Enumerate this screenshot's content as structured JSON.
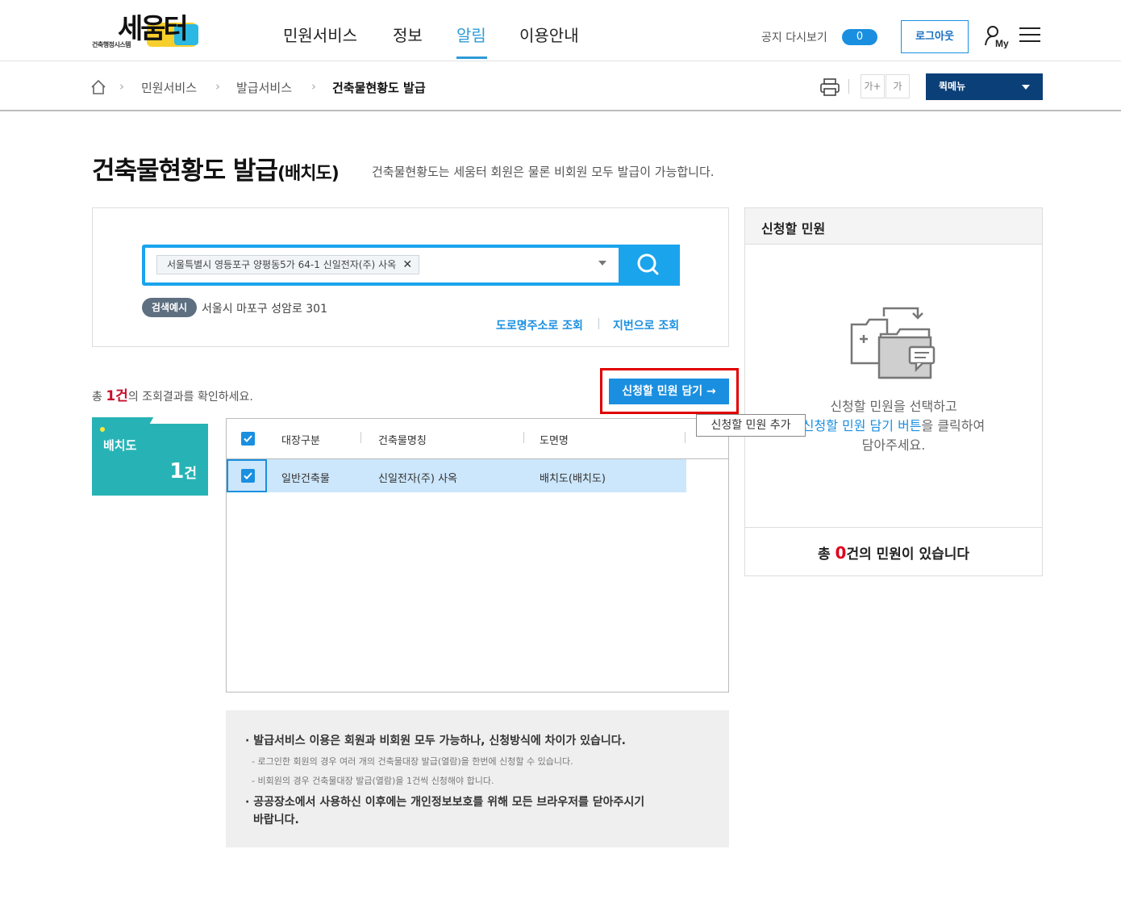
{
  "header": {
    "logo_main": "세움터",
    "logo_sub": "건축행정시스템",
    "nav": [
      "민원서비스",
      "정보",
      "알림",
      "이용안내"
    ],
    "active_nav": "알림",
    "notice_label": "공지 다시보기",
    "notice_count": "0",
    "logout_label": "로그아웃",
    "my_label": "My"
  },
  "breadcrumb": {
    "items": [
      "민원서비스",
      "발급서비스",
      "건축물현황도 발급"
    ],
    "font_larger": "가+",
    "font_smaller": "가",
    "quick_menu": "퀵메뉴"
  },
  "page": {
    "title": "건축물현황도 발급",
    "title_suffix": "(배치도)",
    "description": "건축물현황도는 세움터 회원은 물론 비회원 모두 발급이 가능합니다."
  },
  "search": {
    "selected_address": "서울특별시 영등포구 양평동5가 64-1 신일전자(주) 사옥",
    "example_badge": "검색예시",
    "example_text": "서울시 마포구 성암로 301",
    "link_road": "도로명주소로 조회",
    "link_jibun": "지번으로 조회"
  },
  "results": {
    "total_prefix": "총 ",
    "total_count": "1건",
    "total_suffix": "의 조회결과를 확인하세요.",
    "add_button": "신청할 민원 담기 →",
    "tooltip": "신청할 민원 추가",
    "side_tab_label": "배치도",
    "side_tab_count": "1",
    "side_tab_unit": "건",
    "columns": [
      "대장구분",
      "건축물명칭",
      "도면명"
    ],
    "rows": [
      {
        "type": "일반건축물",
        "name": "신일전자(주) 사옥",
        "drawing": "배치도(배치도)",
        "checked": true
      }
    ]
  },
  "notes": {
    "main1": "· 발급서비스 이용은 회원과 비회원 모두 가능하나, 신청방식에 차이가 있습니다.",
    "sub1": "- 로그인한 회원의 경우 여러 개의 건축물대장 발급(열람)을 한번에 신청할 수 있습니다.",
    "sub2": "- 비회원의 경우 건축물대장 발급(열람)을 1건씩 신청해야 합니다.",
    "main2_line1": "· 공공장소에서 사용하신 이후에는 개인정보보호를 위해 모든 브라우저를 닫아주시기",
    "main2_line2": "바랍니다."
  },
  "cart": {
    "title": "신청할 민원",
    "msg_line1": "신청할 민원을 선택하고",
    "msg_line2_blue": "신청할 민원 담기 버튼",
    "msg_line2_rest": "을 클릭하여",
    "msg_line3": "담아주세요.",
    "total_prefix": "총 ",
    "total_count": "0",
    "total_suffix": "건의 민원이 있습니다"
  },
  "colors": {
    "accent": "#1a8fe0",
    "search_border": "#1aa4ec",
    "tab_teal": "#27b3b5",
    "quick_menu_bg": "#0b3f78",
    "highlight_red": "#e00000",
    "row_selected": "#cce6fb"
  },
  "icons": [
    "home-icon",
    "print-icon",
    "my-user-icon",
    "hamburger-menu-icon",
    "search-icon",
    "close-icon",
    "checkbox-checked-icon",
    "folder-transfer-icon"
  ]
}
